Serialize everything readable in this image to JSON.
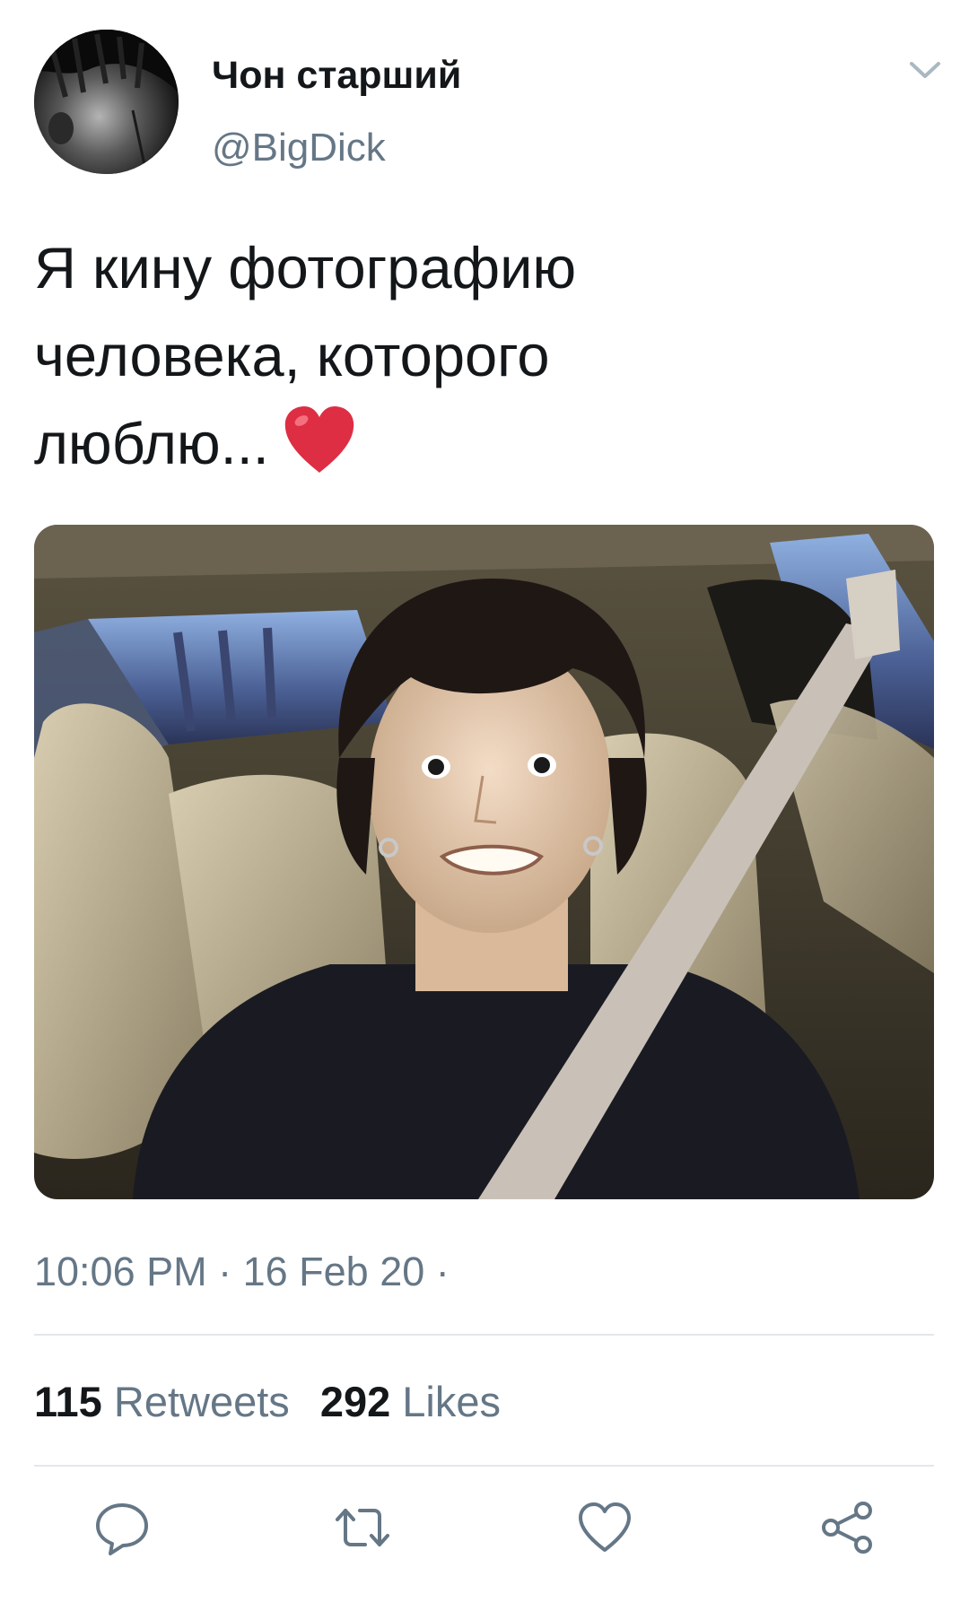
{
  "tweet": {
    "author": {
      "display_name": "Чон старший",
      "handle": "@BigDick",
      "avatar_icon": "user-avatar-photo"
    },
    "menu_icon": "chevron-down-icon",
    "text_lines": [
      "Я кину фотографию",
      "человека, которого",
      "люблю..."
    ],
    "emoji": "red-heart-emoji",
    "media_icon": "photo-attachment",
    "timestamp": "10:06 PM · 16 Feb 20 ·",
    "stats": {
      "retweets_count": "115",
      "retweets_label": "Retweets",
      "likes_count": "292",
      "likes_label": "Likes"
    },
    "actions": {
      "reply_icon": "reply-icon",
      "retweet_icon": "retweet-icon",
      "like_icon": "heart-icon",
      "share_icon": "share-icon"
    }
  },
  "colors": {
    "text_primary": "#14171a",
    "text_secondary": "#657786",
    "divider": "#e1e8ed",
    "heart_emoji": "#dd2e44"
  }
}
